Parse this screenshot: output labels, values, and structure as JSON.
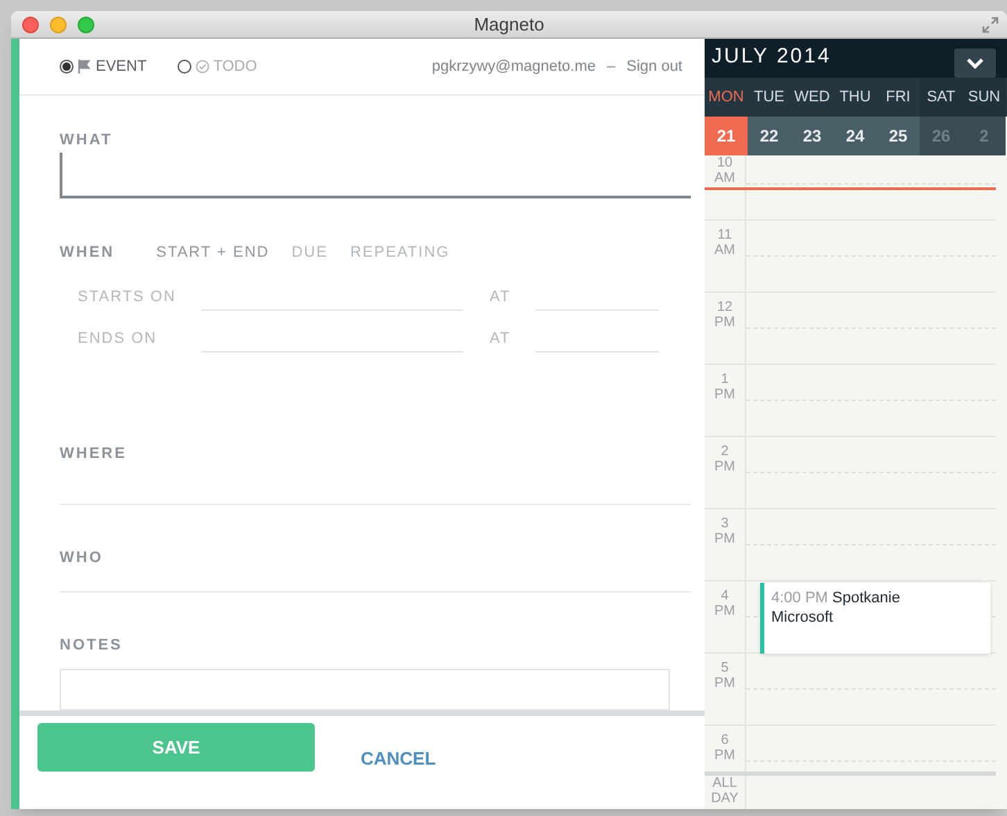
{
  "window": {
    "title": "Magneto"
  },
  "form": {
    "types": [
      {
        "label": "EVENT",
        "kind": "event",
        "selected": true
      },
      {
        "label": "TODO",
        "kind": "todo",
        "selected": false
      }
    ],
    "account": {
      "email": "pgkrzywy@magneto.me",
      "separator": "–",
      "sign_out": "Sign out"
    },
    "what": {
      "label": "WHAT"
    },
    "when": {
      "label": "WHEN",
      "modes": [
        {
          "label": "START + END",
          "selected": true
        },
        {
          "label": "DUE",
          "selected": false
        },
        {
          "label": "REPEATING",
          "selected": false
        }
      ],
      "rows": [
        {
          "label": "STARTS ON",
          "at": "AT"
        },
        {
          "label": "ENDS ON",
          "at": "AT"
        }
      ]
    },
    "where": {
      "label": "WHERE"
    },
    "who": {
      "label": "WHO"
    },
    "notes": {
      "label": "NOTES"
    },
    "save": "SAVE",
    "cancel": "CANCEL"
  },
  "calendar": {
    "month": "JULY 2014",
    "days": [
      {
        "name": "MON",
        "date": "21",
        "kind": "weekday",
        "selected": true
      },
      {
        "name": "TUE",
        "date": "22",
        "kind": "weekday",
        "selected": false
      },
      {
        "name": "WED",
        "date": "23",
        "kind": "weekday",
        "selected": false
      },
      {
        "name": "THU",
        "date": "24",
        "kind": "weekday",
        "selected": false
      },
      {
        "name": "FRI",
        "date": "25",
        "kind": "weekday",
        "selected": false
      },
      {
        "name": "SAT",
        "date": "26",
        "kind": "weekend",
        "selected": false
      },
      {
        "name": "SUN",
        "date": "2",
        "kind": "weekend",
        "selected": false
      }
    ],
    "hours": [
      {
        "hour": "10",
        "period": "AM",
        "now": true
      },
      {
        "hour": "11",
        "period": "AM",
        "now": false
      },
      {
        "hour": "12",
        "period": "PM",
        "now": false
      },
      {
        "hour": "1",
        "period": "PM",
        "now": false
      },
      {
        "hour": "2",
        "period": "PM",
        "now": false
      },
      {
        "hour": "3",
        "period": "PM",
        "now": false
      },
      {
        "hour": "4",
        "period": "PM",
        "now": false,
        "events": [
          {
            "time": "4:00 PM",
            "title": "Spotkanie Microsoft",
            "color": "#2bbfa4"
          }
        ]
      },
      {
        "hour": "5",
        "period": "PM",
        "now": false
      },
      {
        "hour": "6",
        "period": "PM",
        "now": false
      }
    ],
    "all_day": {
      "line_1": "ALL",
      "line_2": "DAY"
    }
  }
}
